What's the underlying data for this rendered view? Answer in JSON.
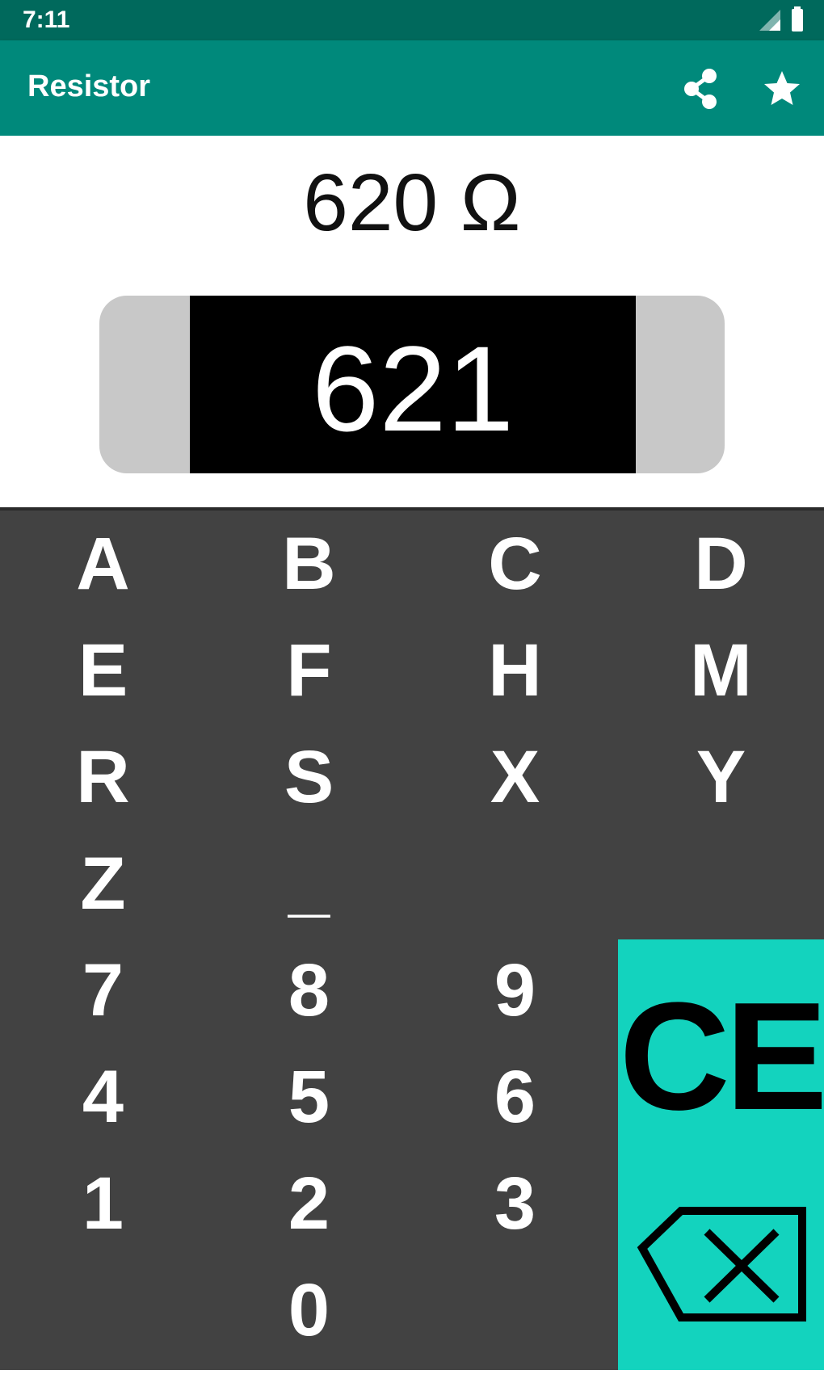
{
  "status_bar": {
    "time": "7:11"
  },
  "app_bar": {
    "title": "Resistor"
  },
  "display": {
    "value": "620 Ω",
    "code": "621"
  },
  "keypad": {
    "keys": [
      "A",
      "B",
      "C",
      "D",
      "E",
      "F",
      "H",
      "M",
      "R",
      "S",
      "X",
      "Y",
      "Z",
      "_",
      "7",
      "8",
      "9",
      "4",
      "5",
      "6",
      "1",
      "2",
      "3",
      "0"
    ],
    "clear_label": "CE"
  },
  "icons": {
    "share": "share-icon",
    "star": "star-icon",
    "backspace": "backspace-icon",
    "signal": "signal-icon",
    "battery": "battery-icon"
  },
  "colors": {
    "status_bar": "#00695c",
    "app_bar": "#00897b",
    "keypad": "#424242",
    "accent": "#13d3be",
    "resistor_body": "#c8c8c8"
  }
}
